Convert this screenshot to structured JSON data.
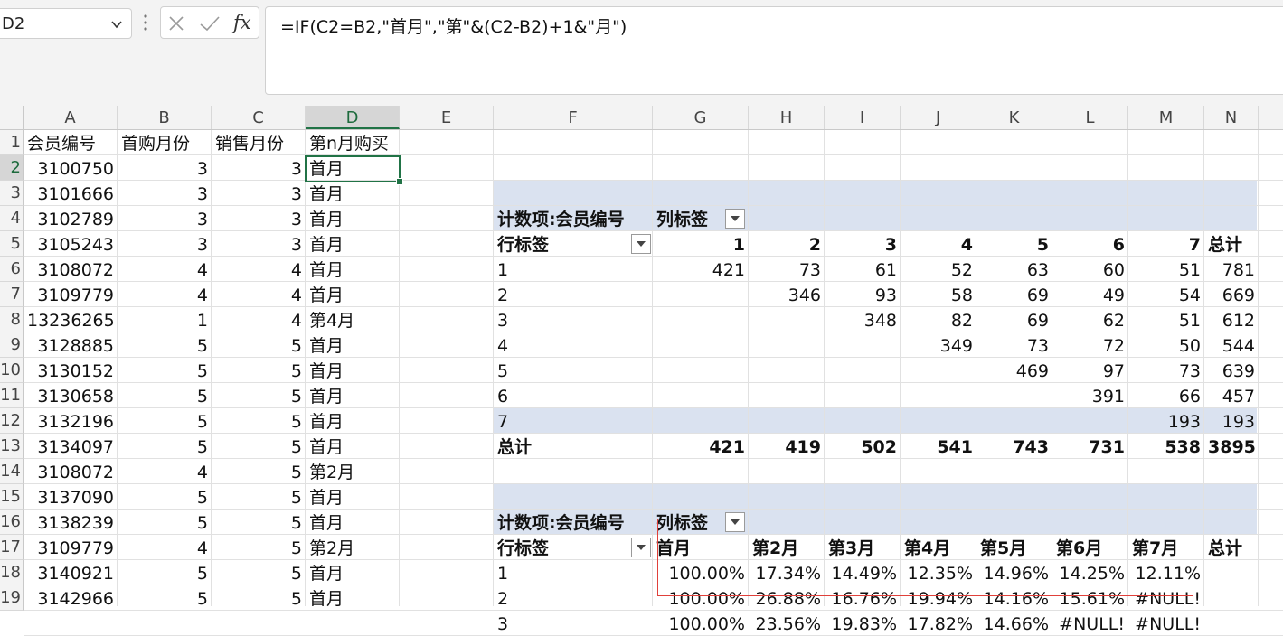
{
  "name_box": "D2",
  "formula_bar": {
    "icons": [
      "cancel-x-icon",
      "enter-check-icon",
      "fx-icon"
    ],
    "formula": "=IF(C2=B2,\"首月\",\"第\"&(C2-B2)+1&\"月\")"
  },
  "columns": [
    "A",
    "B",
    "C",
    "D",
    "E",
    "F",
    "G",
    "H",
    "I",
    "J",
    "K",
    "L",
    "M",
    "N"
  ],
  "selected_cell": "D2",
  "rows": [
    {
      "n": "1",
      "A": "会员编号",
      "B": "首购月份",
      "C": "销售月份",
      "D": "第n月购买"
    },
    {
      "n": "2",
      "A": "3100750",
      "B": "3",
      "C": "3",
      "D": "首月"
    },
    {
      "n": "3",
      "A": "3101666",
      "B": "3",
      "C": "3",
      "D": "首月"
    },
    {
      "n": "4",
      "A": "3102789",
      "B": "3",
      "C": "3",
      "D": "首月"
    },
    {
      "n": "5",
      "A": "3105243",
      "B": "3",
      "C": "3",
      "D": "首月"
    },
    {
      "n": "6",
      "A": "3108072",
      "B": "4",
      "C": "4",
      "D": "首月"
    },
    {
      "n": "7",
      "A": "3109779",
      "B": "4",
      "C": "4",
      "D": "首月"
    },
    {
      "n": "8",
      "A": "13236265",
      "B": "1",
      "C": "4",
      "D": "第4月"
    },
    {
      "n": "9",
      "A": "3128885",
      "B": "5",
      "C": "5",
      "D": "首月"
    },
    {
      "n": "10",
      "A": "3130152",
      "B": "5",
      "C": "5",
      "D": "首月"
    },
    {
      "n": "11",
      "A": "3130658",
      "B": "5",
      "C": "5",
      "D": "首月"
    },
    {
      "n": "12",
      "A": "3132196",
      "B": "5",
      "C": "5",
      "D": "首月"
    },
    {
      "n": "13",
      "A": "3134097",
      "B": "5",
      "C": "5",
      "D": "首月"
    },
    {
      "n": "14",
      "A": "3108072",
      "B": "4",
      "C": "5",
      "D": "第2月"
    },
    {
      "n": "15",
      "A": "3137090",
      "B": "5",
      "C": "5",
      "D": "首月"
    },
    {
      "n": "16",
      "A": "3138239",
      "B": "5",
      "C": "5",
      "D": "首月"
    },
    {
      "n": "17",
      "A": "3109779",
      "B": "4",
      "C": "5",
      "D": "第2月"
    },
    {
      "n": "18",
      "A": "3140921",
      "B": "5",
      "C": "5",
      "D": "首月"
    },
    {
      "n": "19",
      "A": "3142966",
      "B": "5",
      "C": "5",
      "D": "首月"
    }
  ],
  "pivot1": {
    "title": "计数项:会员编号",
    "col_label": "列标签",
    "row_label": "行标签",
    "headers": [
      "1",
      "2",
      "3",
      "4",
      "5",
      "6",
      "7",
      "总计"
    ],
    "rows": [
      [
        "1",
        "421",
        "73",
        "61",
        "52",
        "63",
        "60",
        "51",
        "781"
      ],
      [
        "2",
        "",
        "346",
        "93",
        "58",
        "69",
        "49",
        "54",
        "669"
      ],
      [
        "3",
        "",
        "",
        "348",
        "82",
        "69",
        "62",
        "51",
        "612"
      ],
      [
        "4",
        "",
        "",
        "",
        "349",
        "73",
        "72",
        "50",
        "544"
      ],
      [
        "5",
        "",
        "",
        "",
        "",
        "469",
        "97",
        "73",
        "639"
      ],
      [
        "6",
        "",
        "",
        "",
        "",
        "",
        "391",
        "66",
        "457"
      ],
      [
        "7",
        "",
        "",
        "",
        "",
        "",
        "",
        "193",
        "193"
      ]
    ],
    "total": [
      "总计",
      "421",
      "419",
      "502",
      "541",
      "743",
      "731",
      "538",
      "3895"
    ]
  },
  "pivot2": {
    "title": "计数项:会员编号",
    "col_label": "列标签",
    "row_label": "行标签",
    "headers": [
      "首月",
      "第2月",
      "第3月",
      "第4月",
      "第5月",
      "第6月",
      "第7月",
      "总计"
    ],
    "rows": [
      [
        "1",
        "100.00%",
        "17.34%",
        "14.49%",
        "12.35%",
        "14.96%",
        "14.25%",
        "12.11%",
        ""
      ],
      [
        "2",
        "100.00%",
        "26.88%",
        "16.76%",
        "19.94%",
        "14.16%",
        "15.61%",
        "#NULL!",
        ""
      ],
      [
        "3",
        "100.00%",
        "23.56%",
        "19.83%",
        "17.82%",
        "14.66%",
        "#NULL!",
        "#NULL!",
        ""
      ]
    ]
  },
  "colors": {
    "accent": "#217346",
    "pivot_band": "#dae2f0",
    "highlight_box": "#e0403a"
  }
}
